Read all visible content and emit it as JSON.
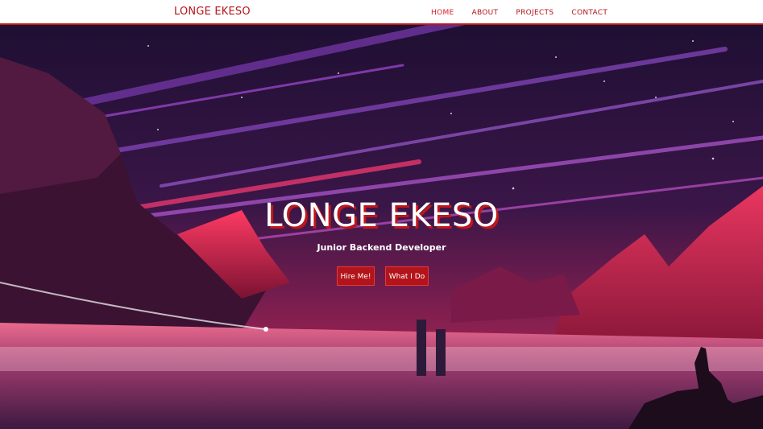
{
  "navbar": {
    "brand": "LONGE EKESO",
    "links": [
      "HOME",
      "ABOUT",
      "PROJECTS",
      "CONTACT"
    ],
    "active": "HOME"
  },
  "hero": {
    "title": "LONGE EKESO",
    "subtitle": "Junior Backend Developer",
    "buttons": {
      "hire": "Hire Me!",
      "what": "What I Do"
    }
  },
  "colors": {
    "accent": "#b3141a",
    "nav_bg": "#ffffff",
    "sky": "#2a1438"
  }
}
